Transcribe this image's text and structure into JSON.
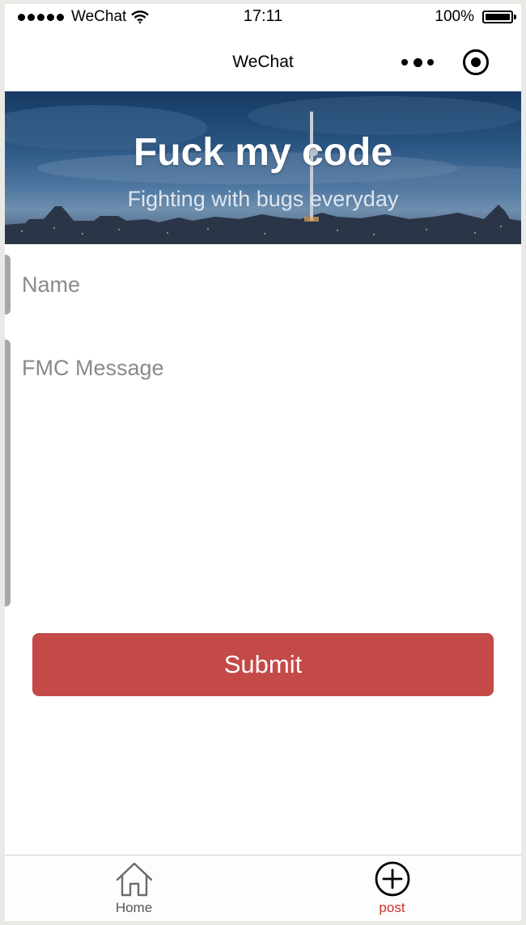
{
  "status_bar": {
    "carrier": "WeChat",
    "time": "17:11",
    "battery": "100%",
    "icons": [
      "signal-dots-icon",
      "wifi-icon",
      "battery-icon"
    ]
  },
  "nav_bar": {
    "title": "WeChat",
    "icons": [
      "more-dots-icon",
      "record-icon"
    ]
  },
  "banner": {
    "title": "Fuck my code",
    "subtitle": "Fighting with bugs everyday"
  },
  "form": {
    "name_placeholder": "Name",
    "message_placeholder": "FMC Message",
    "submit_label": "Submit"
  },
  "tab_bar": {
    "tabs": [
      {
        "label": "Home",
        "icon": "home-icon",
        "active": false
      },
      {
        "label": "post",
        "icon": "plus-circle-icon",
        "active": true
      }
    ]
  },
  "colors": {
    "accent": "#c44a47",
    "active_tab": "#d0302c",
    "field_bar": "#a8a8a6"
  }
}
